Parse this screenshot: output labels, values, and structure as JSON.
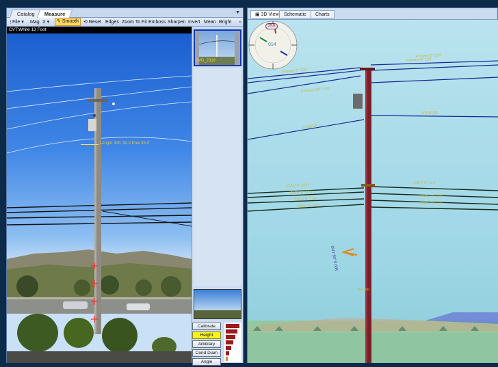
{
  "left_panel": {
    "tabs": [
      "Catalog",
      "Measure"
    ],
    "active_tab": "Measure",
    "toolbar": {
      "file": "File",
      "mag": "Mag",
      "x": "X",
      "smooth": "Smooth",
      "reset": "Reset",
      "edges": "Edges",
      "zoom_to_fit": "Zoom To Fit",
      "emboss": "Emboss",
      "sharpen": "Sharpen",
      "invert": "Invert",
      "mean": "Mean",
      "bright": "Bright"
    },
    "image_caption": "CVT:White 13 Foot",
    "pole_annotation": "Length 40ft, 90.9 Pole 45.0'",
    "thumbnail_caption": "IMG_2318",
    "measure_buttons": [
      "Calibrate",
      "Height",
      "Arbitrary",
      "Cond Diam",
      "Angle"
    ],
    "active_measure": "Height"
  },
  "right_panel": {
    "tabs": [
      "3D View",
      "Schematic",
      "Charts"
    ],
    "active_tab": "3D View",
    "compass": {
      "heading": "255",
      "center": "014"
    },
    "wire_labels": [
      "Primary 0° 120'",
      "Primary 0° 120'",
      "Primary 0° 120'",
      "Primary 1/0° 120'",
      "1/0 ACSR",
      "1/0 ACSR",
      "CATV 0° 120'",
      "CATV 0° 120'",
      "CATV 0° 120'",
      "CATV 0° 120'",
      "CATV 0° 120'",
      "CATV 0° 120'",
      "CATV 0° 120'",
      "GUY 90° 0.00ft",
      "Neutral"
    ]
  },
  "colors": {
    "accent_selected": "#ffd86a",
    "measure_active": "#f7f21f",
    "pole": "#7a1e28",
    "primary_wire": "#142896",
    "label_yellow": "#c8b83a"
  }
}
